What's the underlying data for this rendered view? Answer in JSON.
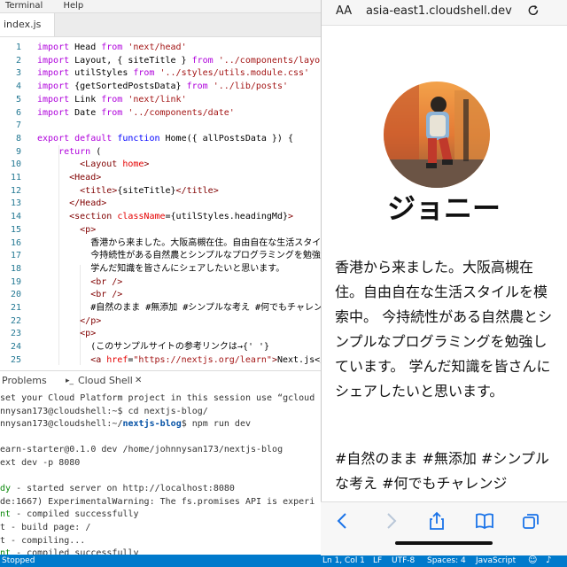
{
  "menubar": {
    "items": [
      "Terminal",
      "Help"
    ]
  },
  "editor": {
    "tab_label": "index.js",
    "lines": [
      {
        "n": "1",
        "segs": [
          {
            "c": "kw2",
            "t": "import"
          },
          {
            "c": "txt",
            "t": " Head "
          },
          {
            "c": "kw2",
            "t": "from"
          },
          {
            "c": "str",
            "t": " 'next/head'"
          }
        ]
      },
      {
        "n": "2",
        "segs": [
          {
            "c": "kw2",
            "t": "import"
          },
          {
            "c": "txt",
            "t": " Layout, { siteTitle } "
          },
          {
            "c": "kw2",
            "t": "from"
          },
          {
            "c": "str",
            "t": " '../components/layout"
          }
        ]
      },
      {
        "n": "3",
        "segs": [
          {
            "c": "kw2",
            "t": "import"
          },
          {
            "c": "txt",
            "t": " utilStyles "
          },
          {
            "c": "kw2",
            "t": "from"
          },
          {
            "c": "str",
            "t": " '../styles/utils.module.css'"
          }
        ]
      },
      {
        "n": "4",
        "segs": [
          {
            "c": "kw2",
            "t": "import"
          },
          {
            "c": "txt",
            "t": " {getSortedPostsData} "
          },
          {
            "c": "kw2",
            "t": "from"
          },
          {
            "c": "str",
            "t": " '../lib/posts'"
          }
        ]
      },
      {
        "n": "5",
        "segs": [
          {
            "c": "kw2",
            "t": "import"
          },
          {
            "c": "txt",
            "t": " Link "
          },
          {
            "c": "kw2",
            "t": "from"
          },
          {
            "c": "str",
            "t": " 'next/link'"
          }
        ]
      },
      {
        "n": "6",
        "segs": [
          {
            "c": "kw2",
            "t": "import"
          },
          {
            "c": "txt",
            "t": " Date "
          },
          {
            "c": "kw2",
            "t": "from"
          },
          {
            "c": "str",
            "t": " '../components/date'"
          }
        ]
      },
      {
        "n": "7",
        "segs": []
      },
      {
        "n": "8",
        "segs": [
          {
            "c": "kw2",
            "t": "export"
          },
          {
            "c": "kw2",
            "t": " default"
          },
          {
            "c": "kw",
            "t": " function"
          },
          {
            "c": "txt",
            "t": " Home({ allPostsData }) {"
          }
        ]
      },
      {
        "n": "9",
        "segs": [
          {
            "c": "kw2",
            "t": "    return"
          },
          {
            "c": "txt",
            "t": " ("
          }
        ]
      },
      {
        "n": "10",
        "segs": [
          {
            "c": "tag",
            "t": "        <Layout"
          },
          {
            "c": "attr",
            "t": " home"
          },
          {
            "c": "tag",
            "t": ">"
          }
        ]
      },
      {
        "n": "11",
        "segs": [
          {
            "c": "tag",
            "t": "      <Head>"
          }
        ]
      },
      {
        "n": "12",
        "segs": [
          {
            "c": "tag",
            "t": "        <title>"
          },
          {
            "c": "txt",
            "t": "{siteTitle}"
          },
          {
            "c": "tag",
            "t": "</title>"
          }
        ]
      },
      {
        "n": "13",
        "segs": [
          {
            "c": "tag",
            "t": "      </Head>"
          }
        ]
      },
      {
        "n": "14",
        "segs": [
          {
            "c": "tag",
            "t": "      <section"
          },
          {
            "c": "attr",
            "t": " className"
          },
          {
            "c": "txt",
            "t": "={utilStyles.headingMd}"
          },
          {
            "c": "tag",
            "t": ">"
          }
        ]
      },
      {
        "n": "15",
        "segs": [
          {
            "c": "tag",
            "t": "        <p>"
          }
        ]
      },
      {
        "n": "16",
        "segs": [
          {
            "c": "txt",
            "t": "          香港から来ました。大阪高槻在住。自由自在な生活スタイ"
          }
        ]
      },
      {
        "n": "17",
        "segs": [
          {
            "c": "txt",
            "t": "          今持続性がある自然農とシンプルなプログラミングを勉強"
          }
        ]
      },
      {
        "n": "18",
        "segs": [
          {
            "c": "txt",
            "t": "          学んだ知識を皆さんにシェアしたいと思います。"
          }
        ]
      },
      {
        "n": "19",
        "segs": [
          {
            "c": "tag",
            "t": "          <br />"
          }
        ]
      },
      {
        "n": "20",
        "segs": [
          {
            "c": "tag",
            "t": "          <br />"
          }
        ]
      },
      {
        "n": "21",
        "segs": [
          {
            "c": "txt",
            "t": "          #自然のまま #無添加 #シンプルな考え #何でもチャレン"
          }
        ]
      },
      {
        "n": "22",
        "segs": [
          {
            "c": "tag",
            "t": "        </p>"
          }
        ]
      },
      {
        "n": "23",
        "segs": [
          {
            "c": "tag",
            "t": "        <p>"
          }
        ]
      },
      {
        "n": "24",
        "segs": [
          {
            "c": "txt",
            "t": "          (このサンプルサイトの参考リンクは→{' '}"
          }
        ]
      },
      {
        "n": "25",
        "segs": [
          {
            "c": "tag",
            "t": "          <a"
          },
          {
            "c": "attr",
            "t": " href"
          },
          {
            "c": "txt",
            "t": "="
          },
          {
            "c": "str",
            "t": "\"https://nextjs.org/learn\""
          },
          {
            "c": "tag",
            "t": ">"
          },
          {
            "c": "txt",
            "t": "Next.js</a"
          }
        ]
      }
    ]
  },
  "panel": {
    "tab_problems": "Problems",
    "tab_shell": "Cloud Shell"
  },
  "terminal": {
    "lines": [
      {
        "segs": [
          {
            "c": "",
            "t": "set your Cloud Platform project in this session use “gcloud"
          }
        ]
      },
      {
        "segs": [
          {
            "c": "",
            "t": "nnysan173@cloudshell:~$ cd nextjs-blog/"
          }
        ]
      },
      {
        "segs": [
          {
            "c": "",
            "t": "nnysan173@cloudshell:~/"
          },
          {
            "c": "tblue",
            "t": "nextjs-blog"
          },
          {
            "c": "",
            "t": "$ npm run dev"
          }
        ]
      },
      {
        "segs": [
          {
            "c": "",
            "t": ""
          }
        ]
      },
      {
        "segs": [
          {
            "c": "",
            "t": "earn-starter@0.1.0 dev /home/johnnysan173/nextjs-blog"
          }
        ]
      },
      {
        "segs": [
          {
            "c": "",
            "t": "ext dev -p 8080"
          }
        ]
      },
      {
        "segs": [
          {
            "c": "",
            "t": ""
          }
        ]
      },
      {
        "segs": [
          {
            "c": "tgreen",
            "t": "dy"
          },
          {
            "c": "",
            "t": " - started server on http://localhost:8080"
          }
        ]
      },
      {
        "segs": [
          {
            "c": "",
            "t": "de:1667) ExperimentalWarning: The fs.promises API is experi"
          }
        ]
      },
      {
        "segs": [
          {
            "c": "tgreen",
            "t": "nt"
          },
          {
            "c": "",
            "t": " - compiled successfully"
          }
        ]
      },
      {
        "segs": [
          {
            "c": "",
            "t": "t - build page: /"
          }
        ]
      },
      {
        "segs": [
          {
            "c": "",
            "t": "t - compiling..."
          }
        ]
      },
      {
        "segs": [
          {
            "c": "tgreen",
            "t": "nt"
          },
          {
            "c": "",
            "t": " - compiled successfully"
          }
        ]
      }
    ]
  },
  "statusbar": {
    "left": "Stopped",
    "position": "Ln 1, Col 1",
    "eol": "LF",
    "encoding": "UTF-8",
    "indent": "Spaces: 4",
    "language": "JavaScript"
  },
  "browser": {
    "text_size_label": "AA",
    "url": "asia-east1.cloudshell.dev",
    "site_name": "ジョニー",
    "bio": "香港から来ました。大阪高槻在住。自由自在な生活スタイルを模索中。 今持続性がある自然農とシンプルなプログラミングを勉強しています。 学んだ知識を皆さんにシェアしたいと思います。",
    "tags": "#自然のまま #無添加 #シンプルな考え #何でもチャレンジ"
  },
  "icons": {
    "reload": "reload-icon",
    "back": "back-arrow-icon",
    "forward": "forward-arrow-icon",
    "share": "share-icon",
    "bookmarks": "bookmarks-icon",
    "tabs": "tabs-icon"
  }
}
